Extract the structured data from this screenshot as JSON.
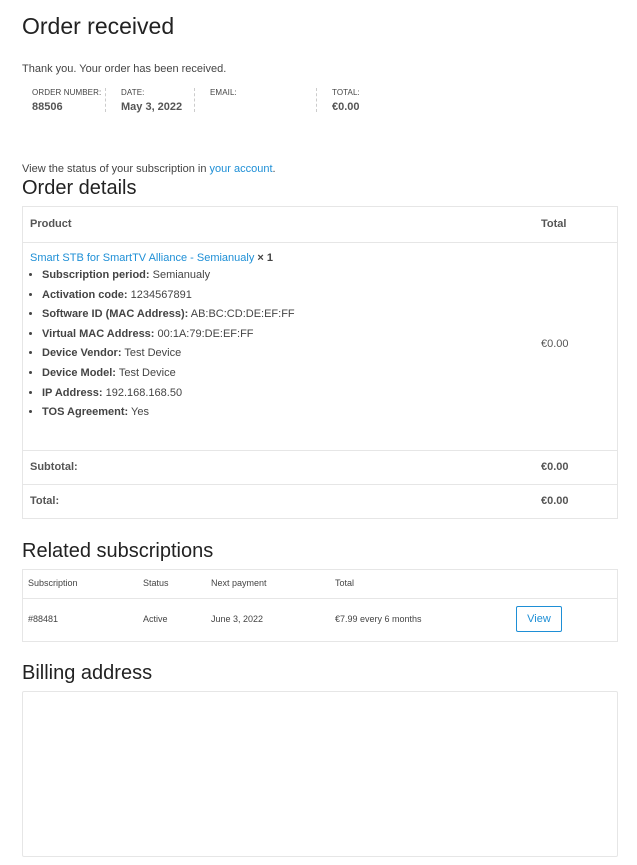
{
  "page": {
    "title": "Order received",
    "thank_you": "Thank you. Your order has been received."
  },
  "overview": {
    "order_number_label": "ORDER NUMBER:",
    "order_number": "88506",
    "date_label": "DATE:",
    "date": "May 3, 2022",
    "email_label": "EMAIL:",
    "email": "",
    "total_label": "TOTAL:",
    "total": "€0.00"
  },
  "subscription_note": {
    "text": "View the status of your subscription in ",
    "link": "your account",
    "suffix": "."
  },
  "order_details": {
    "heading": "Order details",
    "col_product": "Product",
    "col_total": "Total",
    "product_name": "Smart STB for SmartTV Alliance - Semianualy",
    "quantity": "× 1",
    "item_total": "€0.00",
    "meta": [
      {
        "key": "Subscription period:",
        "value": "Semianualy"
      },
      {
        "key": "Activation code:",
        "value": "1234567891"
      },
      {
        "key": "Software ID (MAC Address):",
        "value": "AB:BC:CD:DE:EF:FF"
      },
      {
        "key": "Virtual MAC Address:",
        "value": "00:1A:79:DE:EF:FF"
      },
      {
        "key": "Device Vendor:",
        "value": "Test Device"
      },
      {
        "key": "Device Model:",
        "value": "Test Device"
      },
      {
        "key": "IP Address:",
        "value": "192.168.168.50"
      },
      {
        "key": "TOS Agreement:",
        "value": "Yes"
      }
    ],
    "subtotal_label": "Subtotal:",
    "subtotal": "€0.00",
    "total_label": "Total:",
    "total": "€0.00"
  },
  "related": {
    "heading": "Related subscriptions",
    "col_subscription": "Subscription",
    "col_status": "Status",
    "col_next_payment": "Next payment",
    "col_total": "Total",
    "row": {
      "id": "#88481",
      "status": "Active",
      "next_payment": "June 3, 2022",
      "total": "€7.99 every 6 months",
      "action": "View"
    }
  },
  "billing": {
    "heading": "Billing address"
  },
  "colors": {
    "link": "#1e8fd6",
    "border": "#e6e6e6"
  }
}
